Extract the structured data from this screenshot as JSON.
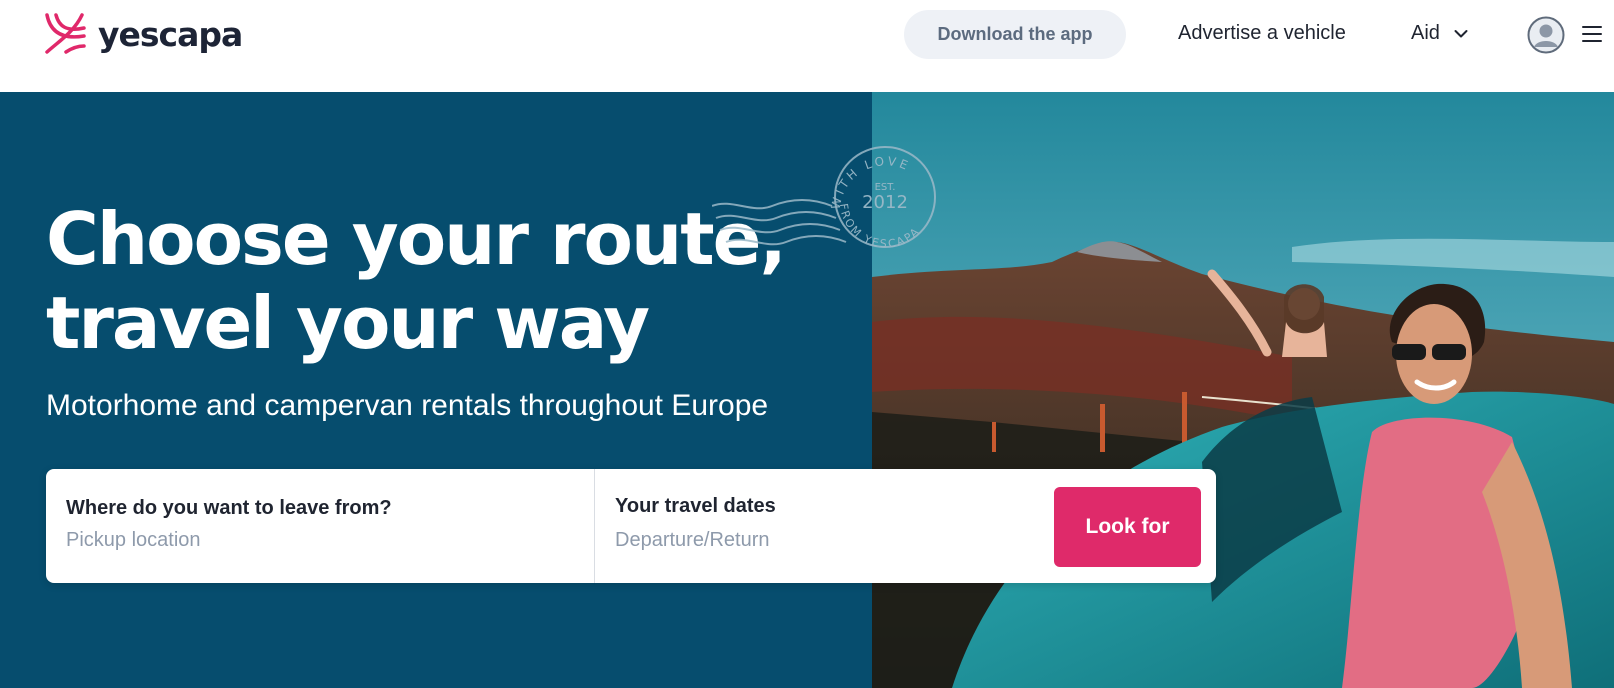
{
  "brand": {
    "name": "yescapa",
    "accent": "#e0286a",
    "dark": "#064d6e"
  },
  "header": {
    "download_label": "Download the app",
    "advertise_label": "Advertise a vehicle",
    "aid_label": "Aid",
    "icons": [
      "yescapa-logo-icon",
      "chevron-down-icon",
      "user-avatar-icon",
      "menu-icon"
    ]
  },
  "hero": {
    "headline_line1": "Choose your route,",
    "headline_line2": "travel your way",
    "subheadline": "Motorhome and campervan rentals throughout Europe",
    "stamp": {
      "arc_top": "WITH LOVE",
      "est": "EST.",
      "year": "2012",
      "arc_bottom": "FROM YESCAPA"
    }
  },
  "search": {
    "location_label": "Where do you want to leave from?",
    "location_placeholder": "Pickup location",
    "location_value": "",
    "dates_label": "Your travel dates",
    "dates_placeholder": "Departure/Return",
    "dates_value": "",
    "submit_label": "Look for"
  }
}
